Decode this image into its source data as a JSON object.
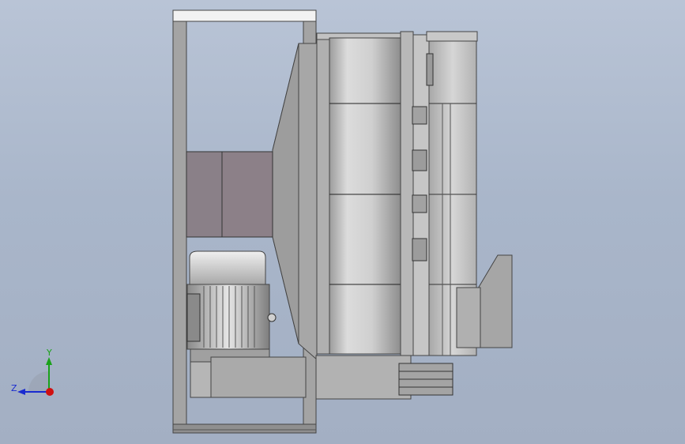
{
  "view": {
    "background_top": "#b9c4d6",
    "background_bottom": "#a3afc3"
  },
  "triad": {
    "x_color": "#d01010",
    "y_color": "#1aa21a",
    "z_color": "#1a2bd0",
    "y_label": "Y",
    "z_label": "Z"
  }
}
